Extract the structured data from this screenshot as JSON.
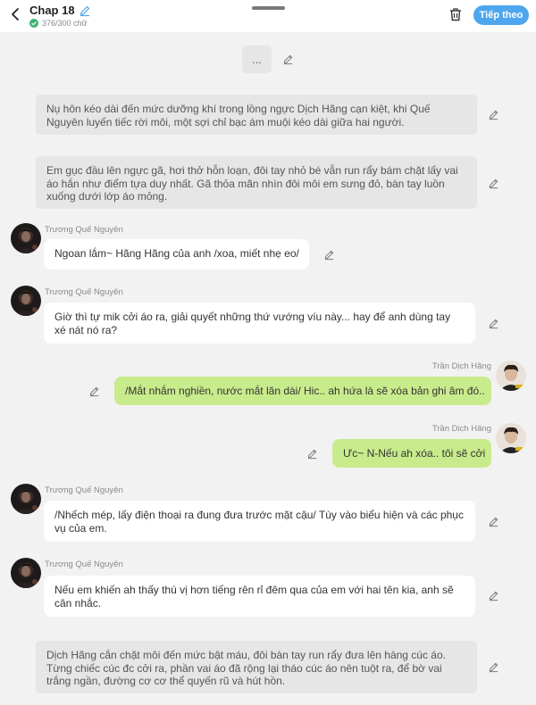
{
  "header": {
    "title": "Chap 18",
    "word_count": "376/300 chữ",
    "next_label": "Tiếp theo",
    "accent": "#4da6ee"
  },
  "placeholder_text": "...",
  "messages": [
    {
      "kind": "narration",
      "text": "Nụ hôn kéo dài đến mức dưỡng khí trong lồng ngực Dịch Hãng cạn kiệt, khi Quế Nguyên luyến tiếc rời môi, một sợi chỉ bạc ám muội kéo dài giữa hai người."
    },
    {
      "kind": "narration",
      "text": "Em gục đầu lên ngực gã, hơi thở hỗn loạn, đôi tay nhỏ bé vẫn run rẩy bám chặt lấy vai áo hắn như điểm tựa duy nhất. Gã thỏa mãn nhìn đôi môi em sưng đỏ, bàn tay luồn xuống dưới lớp áo mỏng."
    },
    {
      "kind": "left",
      "speaker": "Trương Quế Nguyên",
      "text": "Ngoan lắm~ Hãng Hãng của anh /xoa, miết nhẹ eo/"
    },
    {
      "kind": "left",
      "speaker": "Trương Quế Nguyên",
      "text": "Giờ thì tự mik cởi áo ra, giải quyết những thứ vướng víu này... hay để anh dùng tay xé nát nó ra?"
    },
    {
      "kind": "right",
      "speaker": "Trần Dịch Hãng",
      "text": "/Mắt nhắm nghiền, nước mắt lăn dài/ Hic.. ah hứa là sẽ xóa bản ghi âm đó.."
    },
    {
      "kind": "right",
      "speaker": "Trần Dịch Hãng",
      "text": "Ưc~ N-Nếu ah xóa.. tôi sẽ cởi"
    },
    {
      "kind": "left",
      "speaker": "Trương Quế Nguyên",
      "text": "/Nhếch mép, lấy điện thoại ra đung đưa trước mặt cậu/ Tùy vào biểu hiện và các phục vụ của em."
    },
    {
      "kind": "left",
      "speaker": "Trương Quế Nguyên",
      "text": "Nếu em khiến ah thấy thú vị hơn tiếng rên rỉ đêm qua của em với hai tên kia, anh sẽ cân nhắc."
    },
    {
      "kind": "narration",
      "text": "Dịch Hãng cắn chặt môi đến mức bật máu, đôi bàn tay run rẩy đưa lên hàng cúc áo. Từng chiếc cúc đc cởi ra, phần vai áo đã rộng lại tháo cúc áo nên tuột ra, để bờ vai trắng ngần, đường cơ cơ thể quyến rũ và hút hồn."
    }
  ],
  "colors": {
    "background": "#f2f2f2",
    "narration_bg": "#e6e6e6",
    "left_bubble_bg": "#ffffff",
    "right_bubble_bg": "#c8eb8c"
  },
  "icons": {
    "back": "chevron-left-icon",
    "edit": "pencil-icon",
    "verified": "check-circle-icon",
    "delete": "trash-icon"
  }
}
